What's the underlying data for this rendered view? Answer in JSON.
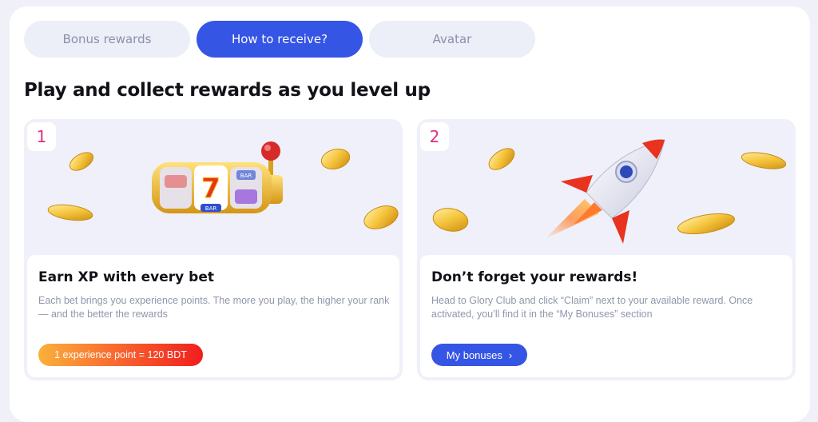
{
  "tabs": [
    {
      "label": "Bonus rewards",
      "active": false
    },
    {
      "label": "How to receive?",
      "active": true
    },
    {
      "label": "Avatar",
      "active": false
    }
  ],
  "heading": "Play and collect rewards as you level up",
  "cards": [
    {
      "number": "1",
      "title": "Earn XP with every bet",
      "description": "Each bet brings you experience points. The more you play, the higher your rank — and the better the rewards",
      "pill": "1 experience point = 120 BDT"
    },
    {
      "number": "2",
      "title": "Don’t forget your rewards!",
      "description": "Head to Glory Club and click “Claim” next to your available reward. Once activated, you’ll find it in the “My Bonuses” section",
      "button": "My bonuses"
    }
  ],
  "slot": {
    "symbol": "7",
    "bar1": "BAR",
    "bar2": "BAR"
  },
  "colors": {
    "accent": "#3555e5",
    "number": "#e0307a",
    "coin": "#f5c33b"
  }
}
